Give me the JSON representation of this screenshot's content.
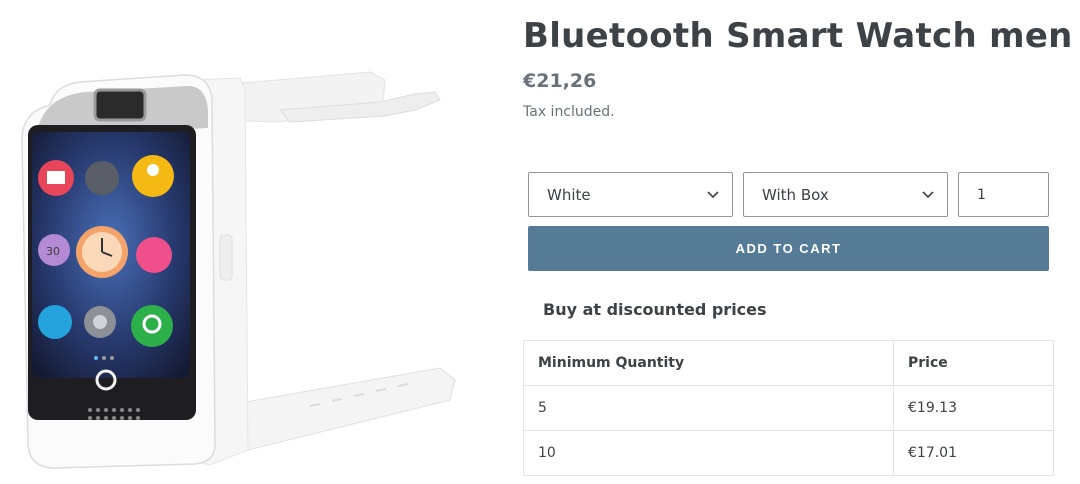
{
  "product": {
    "title": "Bluetooth Smart Watch men",
    "price": "€21,26",
    "tax_note": "Tax included."
  },
  "options": {
    "color_value": "White",
    "package_value": "With Box",
    "quantity_value": "1"
  },
  "actions": {
    "add_to_cart": "ADD TO CART"
  },
  "discounts": {
    "title": "Buy at discounted prices",
    "headers": [
      "Minimum Quantity",
      "Price"
    ],
    "rows": [
      {
        "quantity": "5",
        "price": "€19.13"
      },
      {
        "quantity": "10",
        "price": "€17.01"
      }
    ]
  },
  "watch_screen": {
    "date_number": "30"
  },
  "colors": {
    "button": "#557b97",
    "heading": "#3d4246",
    "muted": "#69727b"
  }
}
